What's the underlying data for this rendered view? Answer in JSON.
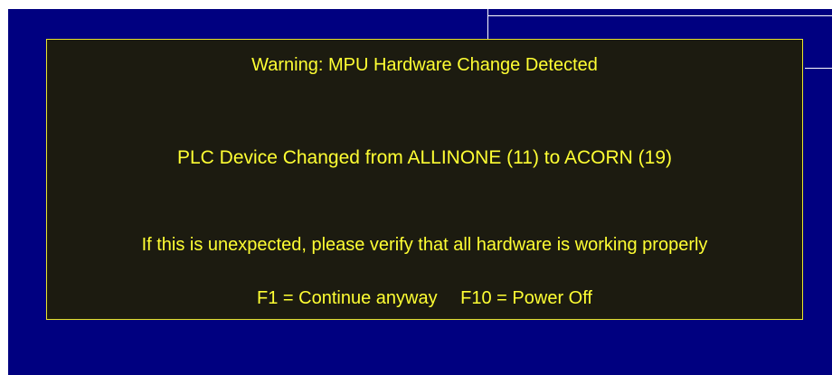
{
  "dialog": {
    "title": "Warning: MPU Hardware Change Detected",
    "message": "PLC Device Changed from ALLINONE (11) to ACORN (19)",
    "advice": "If this is unexpected, please verify that all hardware is working properly",
    "keys": [
      {
        "label": "F1 = Continue anyway"
      },
      {
        "label": "F10 = Power Off"
      }
    ]
  },
  "colors": {
    "screen_background": "#000080",
    "dialog_background": "#1c1b10",
    "dialog_border": "#e8e52c",
    "text": "#ffff33"
  }
}
